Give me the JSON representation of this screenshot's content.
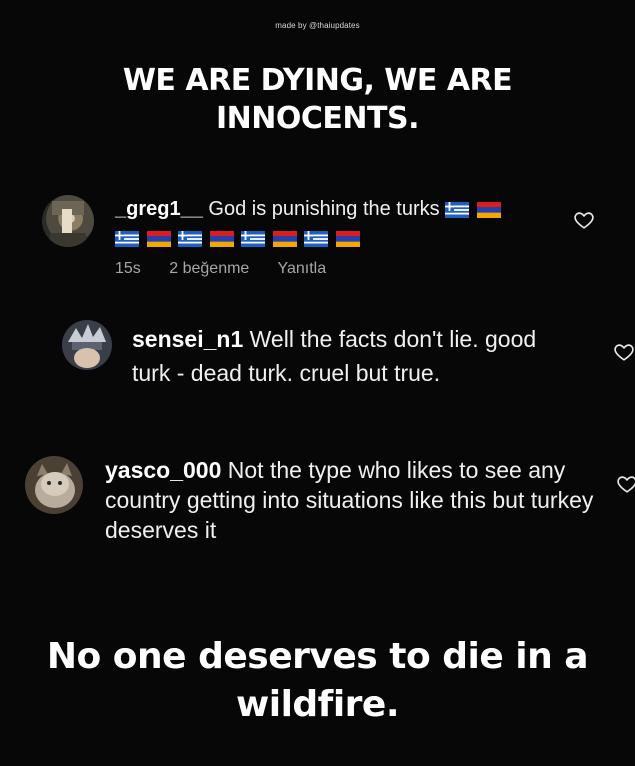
{
  "credit": "made by @thaiupdates",
  "headline": "WE ARE DYING, WE ARE INNOCENTS.",
  "comments": [
    {
      "username": "_greg1__",
      "text": "God is punishing the turks",
      "time": "15s",
      "likes": "2 beğenme",
      "reply": "Yanıtla"
    },
    {
      "username": "sensei_n1",
      "text": "Well the facts don't lie. good turk - dead turk.  cruel but true."
    },
    {
      "username": "yasco_000",
      "text": "Not the type who likes to see any country getting into situations like this but turkey deserves it"
    }
  ],
  "footer": "No one deserves to die in a wildfire.",
  "icons": {
    "like": "heart-icon",
    "flags": [
      "greece-flag-icon",
      "armenia-flag-icon"
    ]
  },
  "colors": {
    "background": "#070707",
    "text": "#f0f0f0",
    "meta": "#a6a6a6"
  }
}
